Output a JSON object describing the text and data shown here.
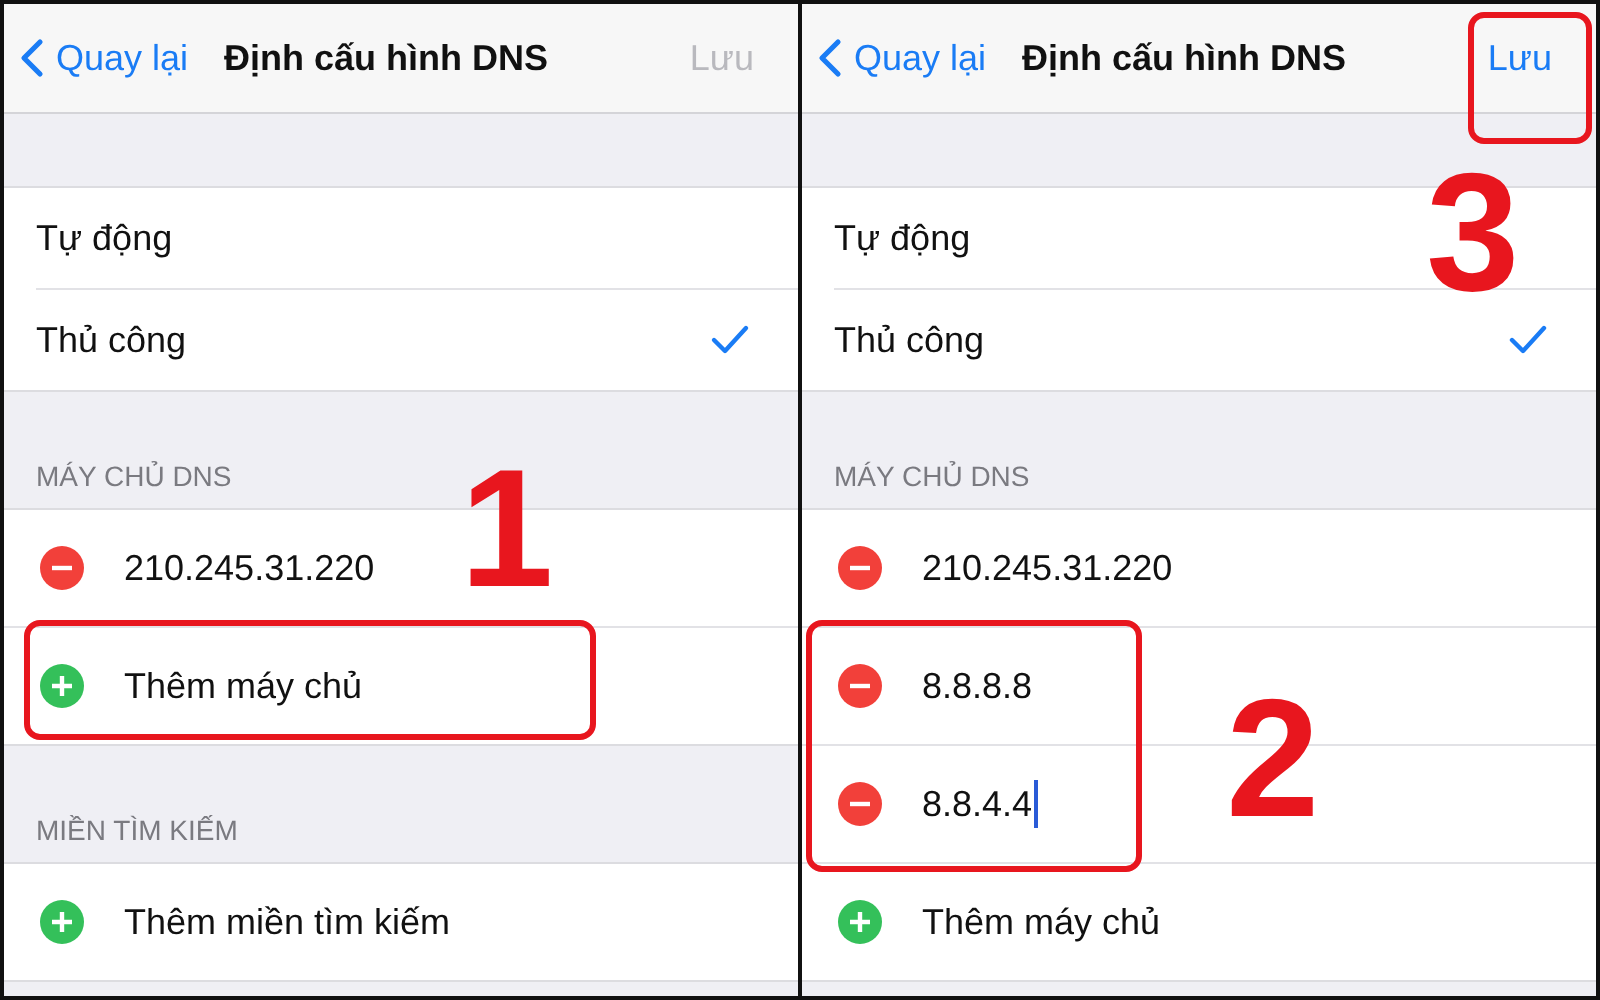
{
  "panels": [
    {
      "nav": {
        "back": "Quay lại",
        "title": "Định cấu hình DNS",
        "save": "Lưu",
        "save_enabled": false
      },
      "modes": [
        {
          "label": "Tự động",
          "selected": false
        },
        {
          "label": "Thủ công",
          "selected": true
        }
      ],
      "sections": [
        {
          "header": "MÁY CHỦ DNS",
          "rows": [
            {
              "kind": "remove",
              "text": "210.245.31.220",
              "focused": false
            },
            {
              "kind": "add",
              "text": "Thêm máy chủ",
              "focused": false
            }
          ]
        },
        {
          "header": "MIỀN TÌM KIẾM",
          "rows": [
            {
              "kind": "add",
              "text": "Thêm miền tìm kiếm",
              "focused": false
            }
          ]
        }
      ],
      "annotations": [
        {
          "kind": "row-box",
          "number": "1"
        }
      ]
    },
    {
      "nav": {
        "back": "Quay lại",
        "title": "Định cấu hình DNS",
        "save": "Lưu",
        "save_enabled": true
      },
      "modes": [
        {
          "label": "Tự động",
          "selected": false
        },
        {
          "label": "Thủ công",
          "selected": true
        }
      ],
      "sections": [
        {
          "header": "MÁY CHỦ DNS",
          "rows": [
            {
              "kind": "remove",
              "text": "210.245.31.220",
              "focused": false
            },
            {
              "kind": "remove",
              "text": "8.8.8.8",
              "focused": false
            },
            {
              "kind": "remove",
              "text": "8.8.4.4",
              "focused": true
            },
            {
              "kind": "add",
              "text": "Thêm máy chủ",
              "focused": false
            }
          ]
        }
      ],
      "annotations": [
        {
          "kind": "rows-box",
          "number": "2"
        },
        {
          "kind": "save-box",
          "number": "3"
        }
      ]
    }
  ]
}
